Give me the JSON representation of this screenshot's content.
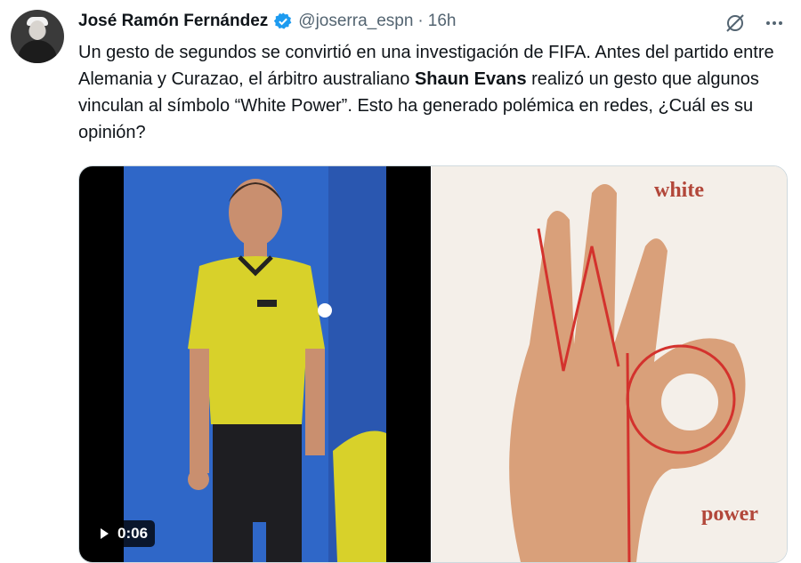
{
  "tweet": {
    "author_name": "José Ramón Fernández",
    "handle": "@joserra_espn",
    "separator": "·",
    "time": "16h",
    "text": {
      "part1": "Un gesto de segundos se convirtió en una investigación de FIFA. Antes del partido entre Alemania y Curazao, el árbitro australiano ",
      "bold": "Shaun Evans",
      "part2": " realizó un gesto que algunos vinculan al símbolo “White Power”. Esto ha generado polémica en redes, ¿Cuál es su opinión?"
    }
  },
  "media": {
    "video_duration": "0:06",
    "image_caption_top": "white",
    "image_caption_bottom": "power"
  },
  "icons": {
    "verified": "verified-badge-icon",
    "grok": "grok-icon",
    "more": "more-options-icon",
    "play": "play-icon"
  },
  "colors": {
    "verified": "#1d9bf0",
    "secondary_text": "#536471",
    "caption": "#b2473a"
  }
}
